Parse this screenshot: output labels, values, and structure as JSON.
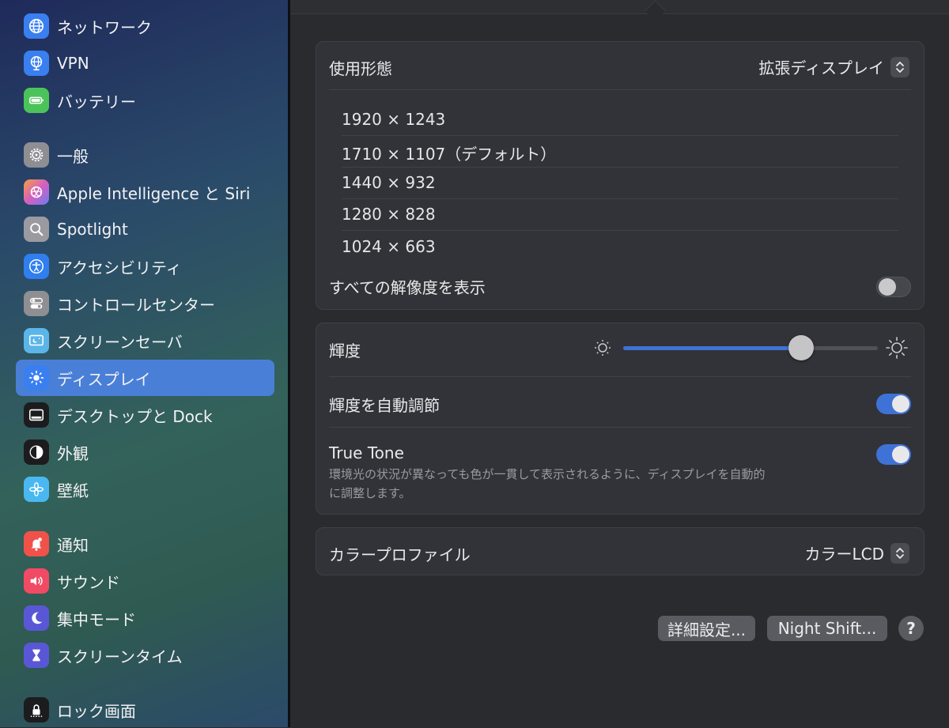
{
  "sidebar": {
    "items": [
      {
        "label": "ネットワーク",
        "icon": "globe-icon",
        "color": "#3a7ff0"
      },
      {
        "label": "VPN",
        "icon": "vpn-globe-icon",
        "color": "#3a7ff0"
      },
      {
        "label": "バッテリー",
        "icon": "battery-icon",
        "color": "#4cc35a"
      },
      {
        "label": "一般",
        "icon": "gear-icon",
        "color": "#8e8e93"
      },
      {
        "label": "Apple Intelligence と Siri",
        "icon": "apple-intelligence-icon",
        "color": "#d65fc0"
      },
      {
        "label": "Spotlight",
        "icon": "magnifier-icon",
        "color": "#9a9aa0"
      },
      {
        "label": "アクセシビリティ",
        "icon": "accessibility-icon",
        "color": "#2f7ff0"
      },
      {
        "label": "コントロールセンター",
        "icon": "toggles-icon",
        "color": "#8e8e93"
      },
      {
        "label": "スクリーンセーバ",
        "icon": "screensaver-icon",
        "color": "#5bb5e8"
      },
      {
        "label": "ディスプレイ",
        "icon": "sun-icon",
        "color": "#3a7ff0"
      },
      {
        "label": "デスクトップと Dock",
        "icon": "dock-icon",
        "color": "#1c1c1e"
      },
      {
        "label": "外観",
        "icon": "appearance-icon",
        "color": "#1c1c1e"
      },
      {
        "label": "壁紙",
        "icon": "wallpaper-icon",
        "color": "#4ab8f0"
      },
      {
        "label": "通知",
        "icon": "bell-icon",
        "color": "#f0524a"
      },
      {
        "label": "サウンド",
        "icon": "speaker-icon",
        "color": "#f04a64"
      },
      {
        "label": "集中モード",
        "icon": "moon-icon",
        "color": "#5a57d6"
      },
      {
        "label": "スクリーンタイム",
        "icon": "hourglass-icon",
        "color": "#5a57d6"
      },
      {
        "label": "ロック画面",
        "icon": "lock-screen-icon",
        "color": "#1c1c1e"
      }
    ]
  },
  "usage": {
    "label": "使用形態",
    "value": "拡張ディスプレイ"
  },
  "resolutions": [
    "1920 × 1243",
    "1710 × 1107（デフォルト）",
    "1440 × 932",
    "1280 × 828",
    "1024 × 663"
  ],
  "show_all": {
    "label": "すべての解像度を表示",
    "on": false
  },
  "brightness": {
    "label": "輝度",
    "level": 0.7
  },
  "auto_brightness": {
    "label": "輝度を自動調節",
    "on": true
  },
  "true_tone": {
    "label": "True Tone",
    "desc_line1": "環境光の状況が異なっても色が一貫して表示されるように、ディスプレイを自動的",
    "desc_line2": "に調整します。",
    "on": true
  },
  "color_profile": {
    "label": "カラープロファイル",
    "value": "カラーLCD"
  },
  "buttons": {
    "advanced": "詳細設定...",
    "night_shift": "Night Shift...",
    "help": "?"
  },
  "colors": {
    "accent": "#3f72d6",
    "selection": "#4a7fd8"
  }
}
